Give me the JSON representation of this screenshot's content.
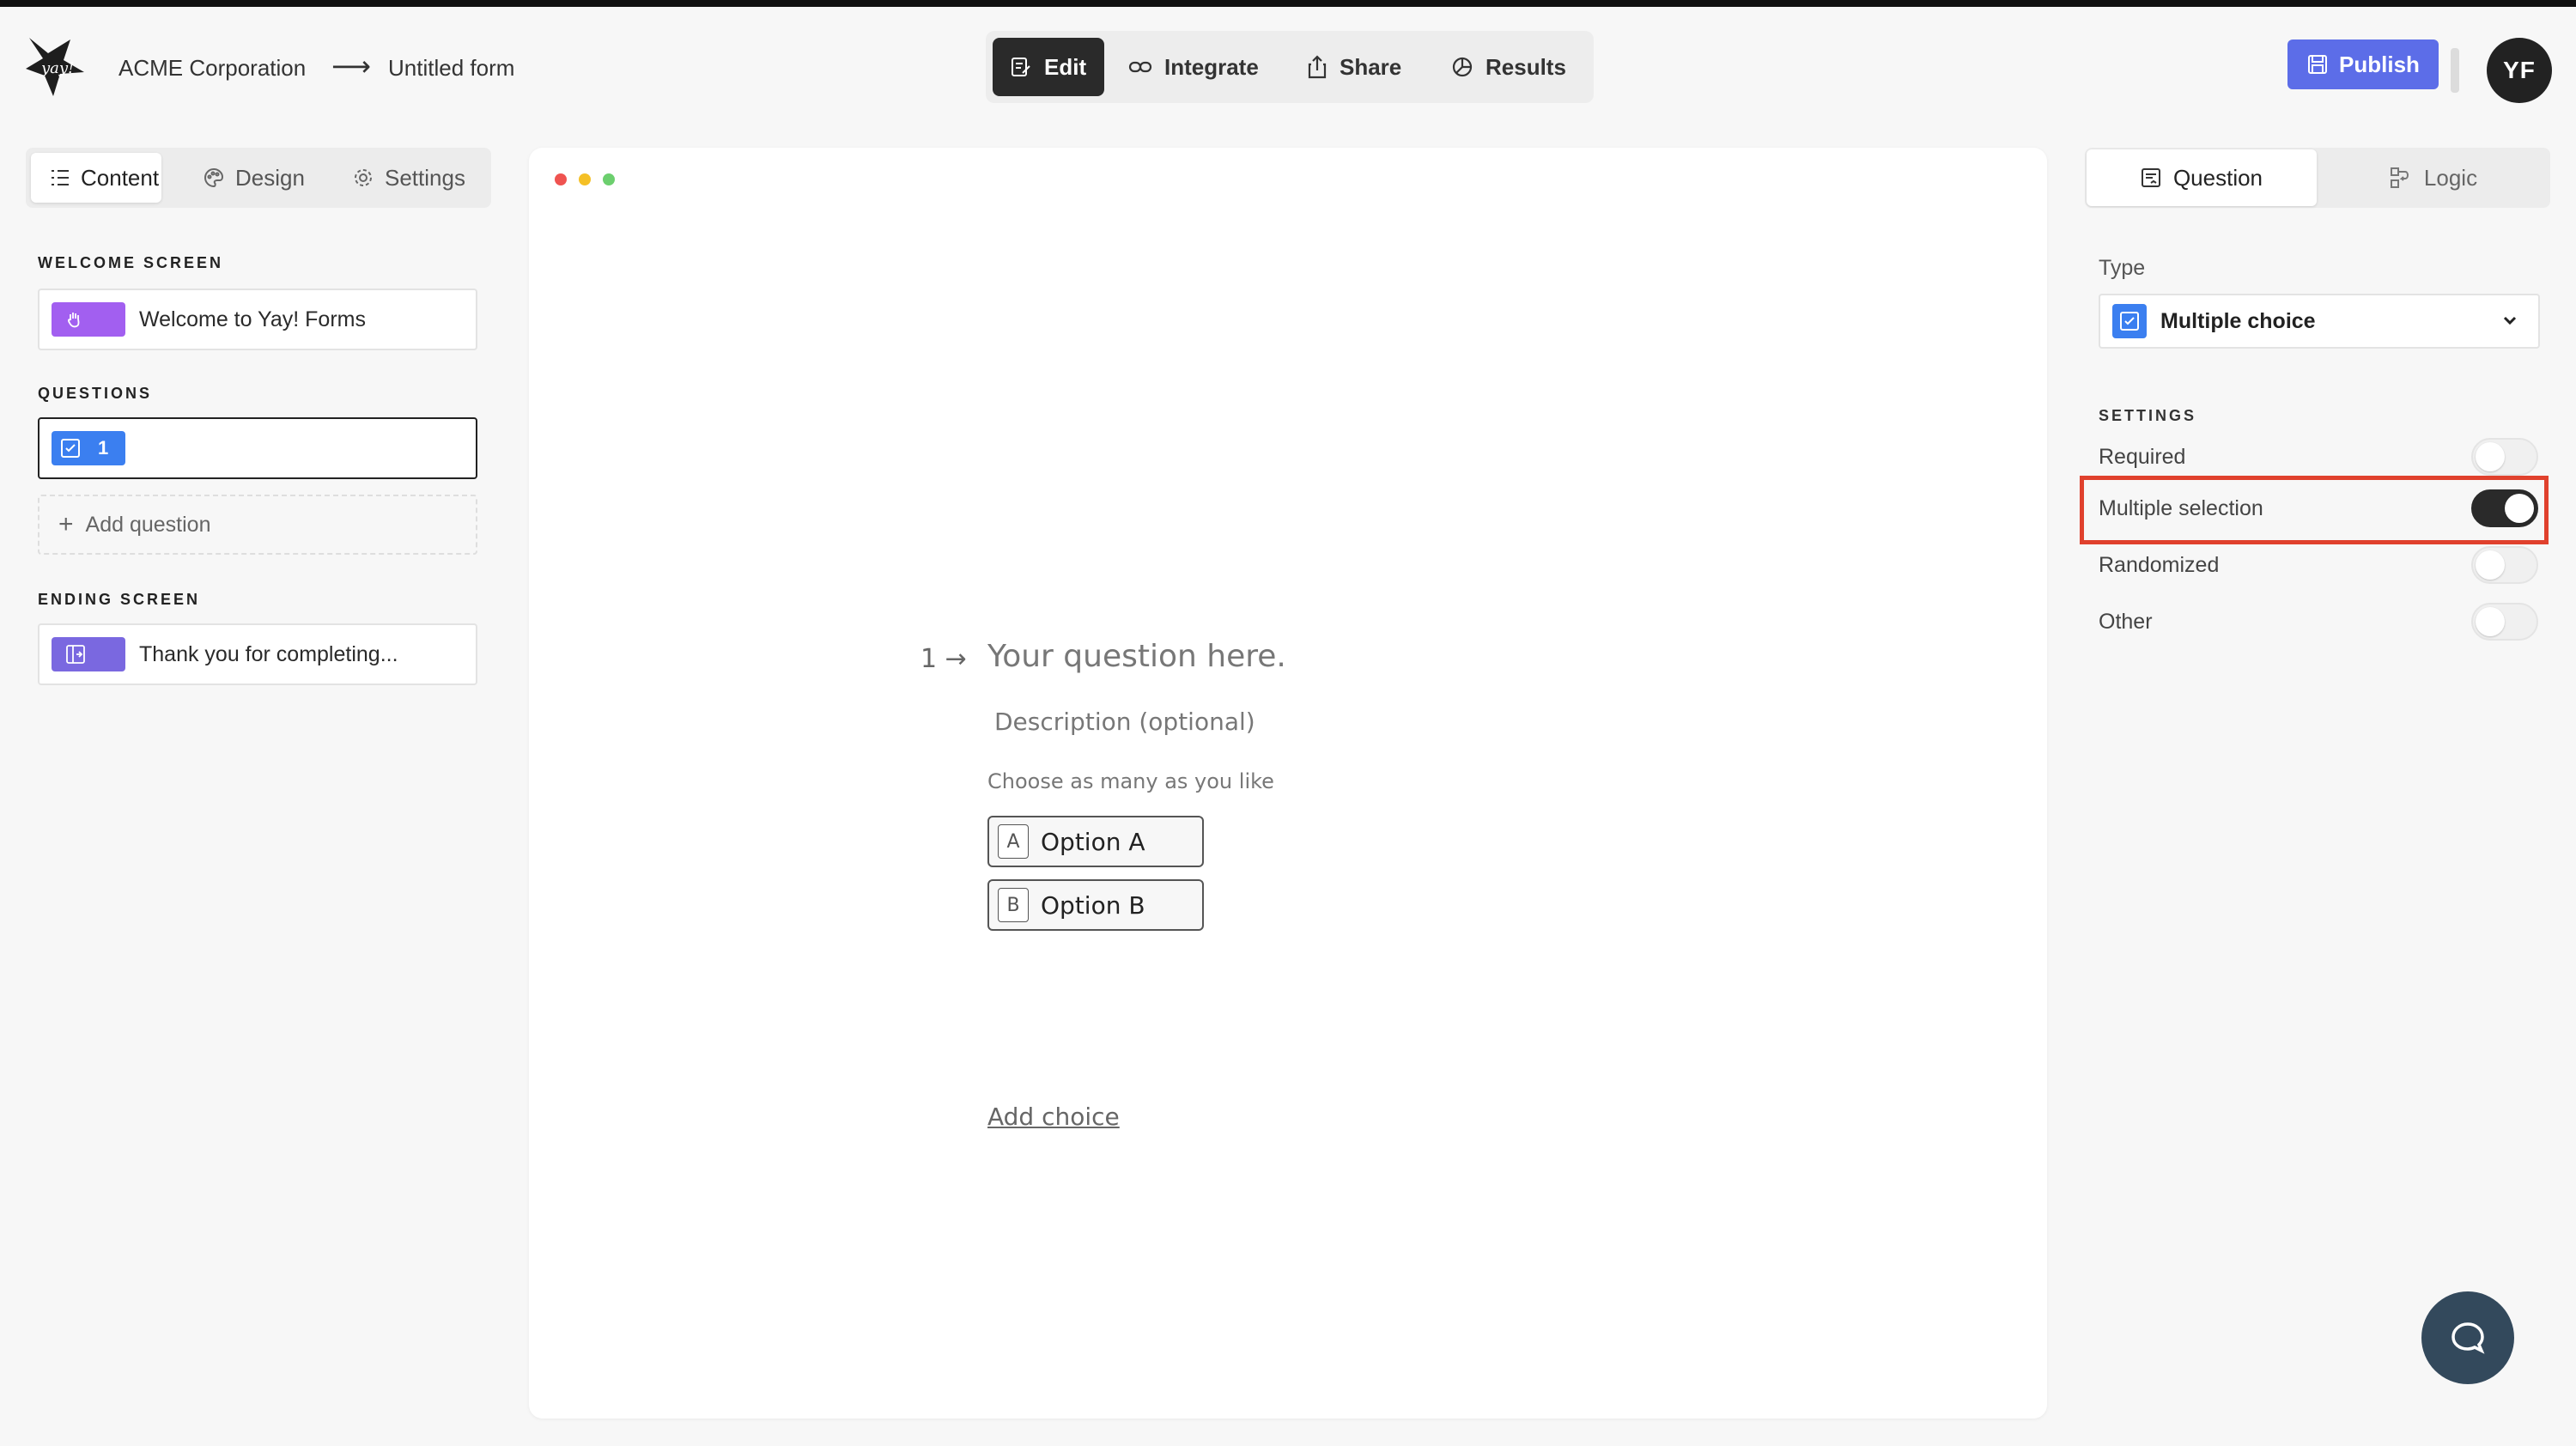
{
  "header": {
    "org": "ACME Corporation",
    "arrow": "⟶",
    "form_title": "Untitled form",
    "modes": [
      {
        "label": "Edit",
        "active": true
      },
      {
        "label": "Integrate",
        "active": false
      },
      {
        "label": "Share",
        "active": false
      },
      {
        "label": "Results",
        "active": false
      }
    ],
    "publish_label": "Publish",
    "avatar_initials": "YF"
  },
  "left_panel": {
    "tabs": [
      {
        "label": "Content",
        "active": true
      },
      {
        "label": "Design",
        "active": false
      },
      {
        "label": "Settings",
        "active": false
      }
    ],
    "welcome_heading": "WELCOME SCREEN",
    "welcome_item": "Welcome to Yay! Forms",
    "questions_heading": "QUESTIONS",
    "question_number": "1",
    "add_question": "Add question",
    "ending_heading": "ENDING SCREEN",
    "ending_item": "Thank you for completing..."
  },
  "canvas": {
    "question_number": "1",
    "question_arrow": "→",
    "question_title": "Your question here.",
    "description": "Description (optional)",
    "hint": "Choose as many as you like",
    "options": [
      {
        "key": "A",
        "label": "Option A"
      },
      {
        "key": "B",
        "label": "Option B"
      }
    ],
    "add_choice": "Add choice"
  },
  "right_panel": {
    "tabs": [
      {
        "label": "Question",
        "active": true
      },
      {
        "label": "Logic",
        "active": false
      }
    ],
    "type_label": "Type",
    "type_value": "Multiple choice",
    "settings_heading": "SETTINGS",
    "settings": [
      {
        "label": "Required",
        "on": false
      },
      {
        "label": "Multiple selection",
        "on": true
      },
      {
        "label": "Randomized",
        "on": false
      },
      {
        "label": "Other",
        "on": false
      }
    ]
  },
  "colors": {
    "accent": "#5c6de8",
    "checkbox_blue": "#3b7ff0",
    "welcome_chip": "#a25ff0",
    "ending_chip": "#7a68e0",
    "highlight_red": "#e0412d",
    "help_bubble": "#33495c"
  }
}
